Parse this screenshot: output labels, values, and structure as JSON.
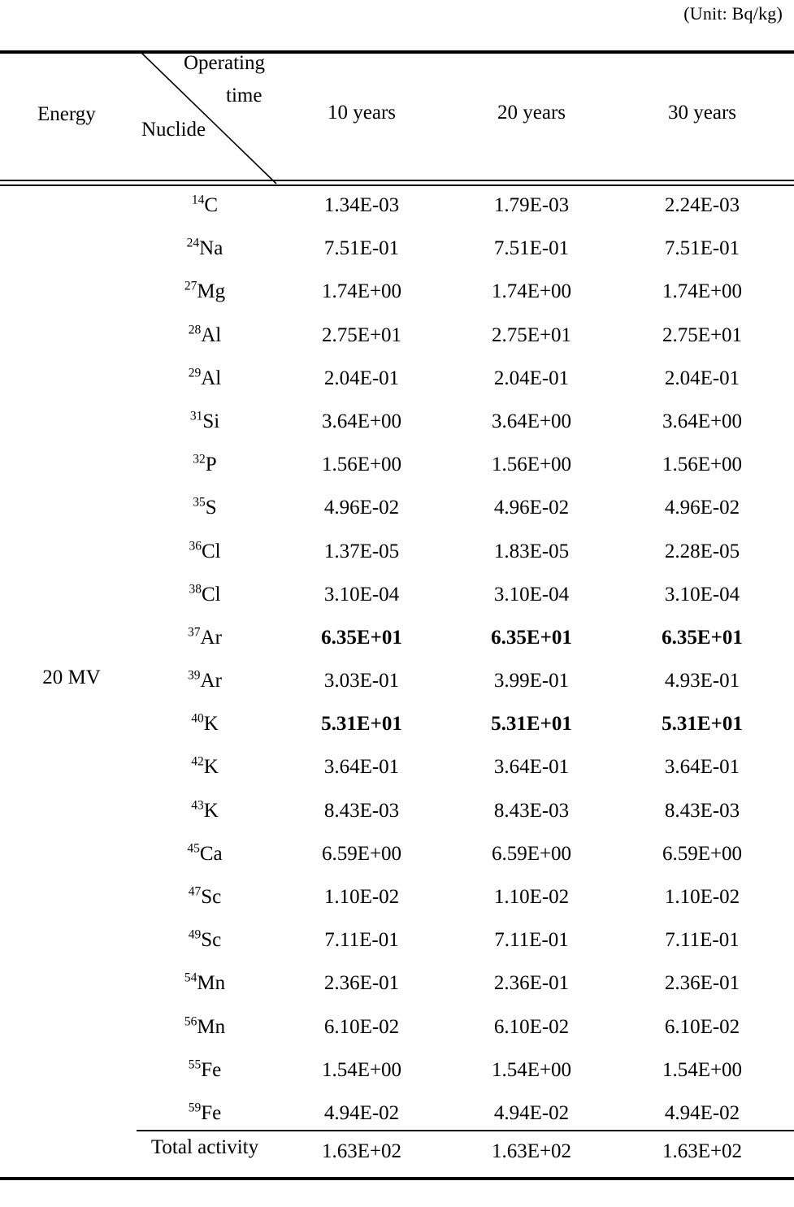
{
  "unit_caption": "(Unit:  Bq/kg)",
  "header": {
    "stub_energy": "Energy",
    "stub_operating": "Operating",
    "stub_time": "time",
    "stub_nuclide": "Nuclide",
    "columns": [
      "10  years",
      "20  years",
      "30  years"
    ]
  },
  "energy_label": "20 MV",
  "total_label": "Total activity",
  "rows": [
    {
      "mass": "14",
      "element": "C",
      "bold": false,
      "values": [
        "1.34E-03",
        "1.79E-03",
        "2.24E-03"
      ]
    },
    {
      "mass": "24",
      "element": "Na",
      "bold": false,
      "values": [
        "7.51E-01",
        "7.51E-01",
        "7.51E-01"
      ]
    },
    {
      "mass": "27",
      "element": "Mg",
      "bold": false,
      "values": [
        "1.74E+00",
        "1.74E+00",
        "1.74E+00"
      ]
    },
    {
      "mass": "28",
      "element": "Al",
      "bold": false,
      "values": [
        "2.75E+01",
        "2.75E+01",
        "2.75E+01"
      ]
    },
    {
      "mass": "29",
      "element": "Al",
      "bold": false,
      "values": [
        "2.04E-01",
        "2.04E-01",
        "2.04E-01"
      ]
    },
    {
      "mass": "31",
      "element": "Si",
      "bold": false,
      "values": [
        "3.64E+00",
        "3.64E+00",
        "3.64E+00"
      ]
    },
    {
      "mass": "32",
      "element": "P",
      "bold": false,
      "values": [
        "1.56E+00",
        "1.56E+00",
        "1.56E+00"
      ]
    },
    {
      "mass": "35",
      "element": "S",
      "bold": false,
      "values": [
        "4.96E-02",
        "4.96E-02",
        "4.96E-02"
      ]
    },
    {
      "mass": "36",
      "element": "Cl",
      "bold": false,
      "values": [
        "1.37E-05",
        "1.83E-05",
        "2.28E-05"
      ]
    },
    {
      "mass": "38",
      "element": "Cl",
      "bold": false,
      "values": [
        "3.10E-04",
        "3.10E-04",
        "3.10E-04"
      ]
    },
    {
      "mass": "37",
      "element": "Ar",
      "bold": true,
      "values": [
        "6.35E+01",
        "6.35E+01",
        "6.35E+01"
      ]
    },
    {
      "mass": "39",
      "element": "Ar",
      "bold": false,
      "values": [
        "3.03E-01",
        "3.99E-01",
        "4.93E-01"
      ]
    },
    {
      "mass": "40",
      "element": "K",
      "bold": true,
      "values": [
        "5.31E+01",
        "5.31E+01",
        "5.31E+01"
      ]
    },
    {
      "mass": "42",
      "element": "K",
      "bold": false,
      "values": [
        "3.64E-01",
        "3.64E-01",
        "3.64E-01"
      ]
    },
    {
      "mass": "43",
      "element": "K",
      "bold": false,
      "values": [
        "8.43E-03",
        "8.43E-03",
        "8.43E-03"
      ]
    },
    {
      "mass": "45",
      "element": "Ca",
      "bold": false,
      "values": [
        "6.59E+00",
        "6.59E+00",
        "6.59E+00"
      ]
    },
    {
      "mass": "47",
      "element": "Sc",
      "bold": false,
      "values": [
        "1.10E-02",
        "1.10E-02",
        "1.10E-02"
      ]
    },
    {
      "mass": "49",
      "element": "Sc",
      "bold": false,
      "values": [
        "7.11E-01",
        "7.11E-01",
        "7.11E-01"
      ]
    },
    {
      "mass": "54",
      "element": "Mn",
      "bold": false,
      "values": [
        "2.36E-01",
        "2.36E-01",
        "2.36E-01"
      ]
    },
    {
      "mass": "56",
      "element": "Mn",
      "bold": false,
      "values": [
        "6.10E-02",
        "6.10E-02",
        "6.10E-02"
      ]
    },
    {
      "mass": "55",
      "element": "Fe",
      "bold": false,
      "values": [
        "1.54E+00",
        "1.54E+00",
        "1.54E+00"
      ]
    },
    {
      "mass": "59",
      "element": "Fe",
      "bold": false,
      "values": [
        "4.94E-02",
        "4.94E-02",
        "4.94E-02"
      ]
    }
  ],
  "total_values": [
    "1.63E+02",
    "1.63E+02",
    "1.63E+02"
  ],
  "chart_data": {
    "type": "table",
    "title": "Induced radioactivity by nuclide and operating time",
    "unit": "Bq/kg",
    "energy": "20 MV",
    "categories": [
      "14C",
      "24Na",
      "27Mg",
      "28Al",
      "29Al",
      "31Si",
      "32P",
      "35S",
      "36Cl",
      "38Cl",
      "37Ar",
      "39Ar",
      "40K",
      "42K",
      "43K",
      "45Ca",
      "47Sc",
      "49Sc",
      "54Mn",
      "56Mn",
      "55Fe",
      "59Fe"
    ],
    "series": [
      {
        "name": "10  years",
        "values": [
          0.00134,
          0.751,
          1.74,
          27.5,
          0.204,
          3.64,
          1.56,
          0.0496,
          1.37e-05,
          0.00031,
          63.5,
          0.303,
          53.1,
          0.364,
          0.00843,
          6.59,
          0.011,
          0.711,
          0.236,
          0.061,
          1.54,
          0.0494
        ],
        "total": 163.0
      },
      {
        "name": "20  years",
        "values": [
          0.00179,
          0.751,
          1.74,
          27.5,
          0.204,
          3.64,
          1.56,
          0.0496,
          1.83e-05,
          0.00031,
          63.5,
          0.399,
          53.1,
          0.364,
          0.00843,
          6.59,
          0.011,
          0.711,
          0.236,
          0.061,
          1.54,
          0.0494
        ],
        "total": 163.0
      },
      {
        "name": "30  years",
        "values": [
          0.00224,
          0.751,
          1.74,
          27.5,
          0.204,
          3.64,
          1.56,
          0.0496,
          2.28e-05,
          0.00031,
          63.5,
          0.493,
          53.1,
          0.364,
          0.00843,
          6.59,
          0.011,
          0.711,
          0.236,
          0.061,
          1.54,
          0.0494
        ],
        "total": 163.0
      }
    ],
    "highlighted_rows": [
      "37Ar",
      "40K"
    ]
  }
}
